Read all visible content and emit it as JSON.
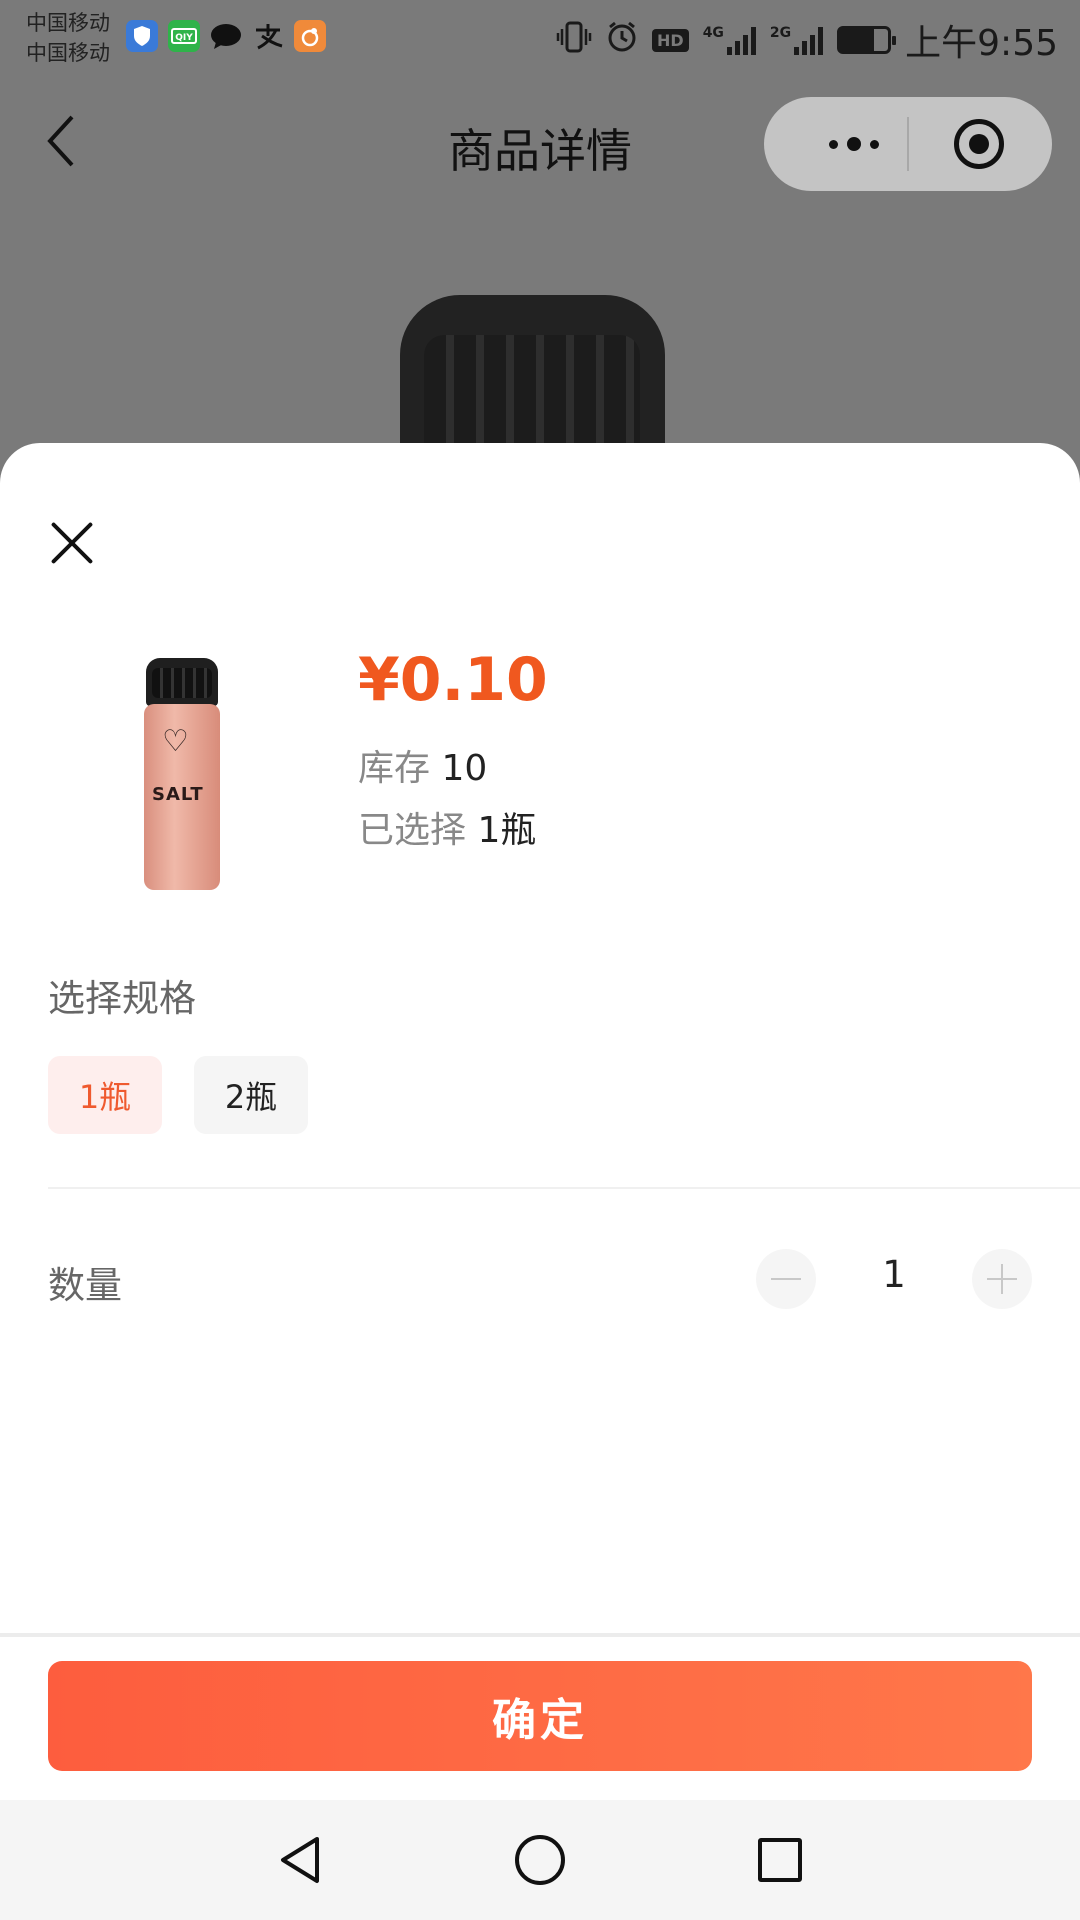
{
  "status_bar": {
    "carrier_1": "中国移动",
    "carrier_2": "中国移动",
    "hd_label": "HD",
    "net_4g": "4G",
    "net_2g": "2G",
    "battery_level": 0.7,
    "time": "上午9:55",
    "app_icons": [
      "shield-app-icon",
      "iqiyi-app-icon",
      "message-app-icon",
      "alipay-app-icon",
      "uc-browser-app-icon"
    ]
  },
  "nav": {
    "title": "商品详情",
    "back_icon": "chevron-left-icon",
    "more_icon": "more-dots-icon",
    "close_icon": "target-close-icon"
  },
  "sheet": {
    "close_icon": "close-icon",
    "product": {
      "price": "¥0.10",
      "stock_label": "库存",
      "stock_value": "10",
      "selected_label": "已选择",
      "selected_value": "1瓶",
      "image_label": "SALT"
    },
    "spec": {
      "title": "选择规格",
      "options": [
        {
          "label": "1瓶",
          "selected": true
        },
        {
          "label": "2瓶",
          "selected": false
        }
      ]
    },
    "quantity": {
      "label": "数量",
      "value": "1"
    },
    "confirm_label": "确定"
  },
  "colors": {
    "accent": "#f0581f",
    "button_gradient_start": "#fd5d3e",
    "button_gradient_end": "#ff774a",
    "selected_bg": "#feeeed",
    "overlay": "#7a7a7a"
  },
  "system_nav": {
    "back_icon": "triangle-back-icon",
    "home_icon": "circle-home-icon",
    "recent_icon": "square-recent-icon"
  }
}
